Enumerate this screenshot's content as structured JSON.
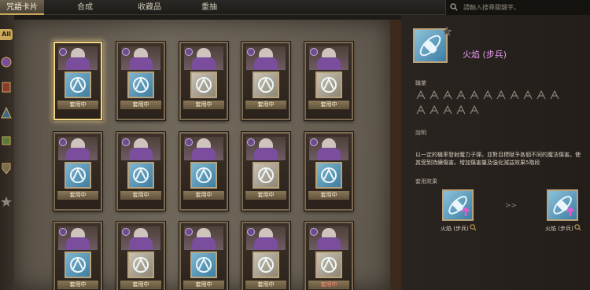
{
  "tabs": [
    {
      "label": "咒語卡片",
      "active": true
    },
    {
      "label": "合成",
      "active": false
    },
    {
      "label": "收藏品",
      "active": false
    },
    {
      "label": "重抽",
      "active": false
    }
  ],
  "search": {
    "placeholder": "請輸入搜尋關鍵字。",
    "icon": "search-icon"
  },
  "rail": {
    "all_label": "All"
  },
  "cards": [
    {
      "status": "套用中",
      "rune": "blue",
      "selected": true
    },
    {
      "status": "套用中",
      "rune": "blue"
    },
    {
      "status": "套用中",
      "rune": "grey"
    },
    {
      "status": "套用中",
      "rune": "grey"
    },
    {
      "status": "套用中",
      "rune": "grey"
    },
    {
      "status": "套用中",
      "rune": "blue"
    },
    {
      "status": "套用中",
      "rune": "blue"
    },
    {
      "status": "套用中",
      "rune": "blue"
    },
    {
      "status": "套用中",
      "rune": "grey"
    },
    {
      "status": "套用中",
      "rune": "blue"
    },
    {
      "status": "套用中",
      "rune": "blue"
    },
    {
      "status": "套用中",
      "rune": "grey"
    },
    {
      "status": "套用中",
      "rune": "blue"
    },
    {
      "status": "套用中",
      "rune": "grey"
    },
    {
      "status": "套用中",
      "rune": "grey",
      "red": true
    }
  ],
  "detail": {
    "name": "火焰 (步兵)",
    "class_label": "職業",
    "desc_label": "說明",
    "description": "以一定的機率發射魔力子彈，並對目標賦予各個不同的魔法傷害。使其受到持續傷害。增加傷害量及強化減益效果5階段",
    "effect_label": "套用效果",
    "effect_from": "火焰 (步兵)",
    "effect_to": "火焰 (步兵)",
    "arrows": ">>",
    "colors": {
      "accent": "#e89cf0",
      "gold": "#c9a85a",
      "rune_blue": "#5d9dbf"
    }
  }
}
